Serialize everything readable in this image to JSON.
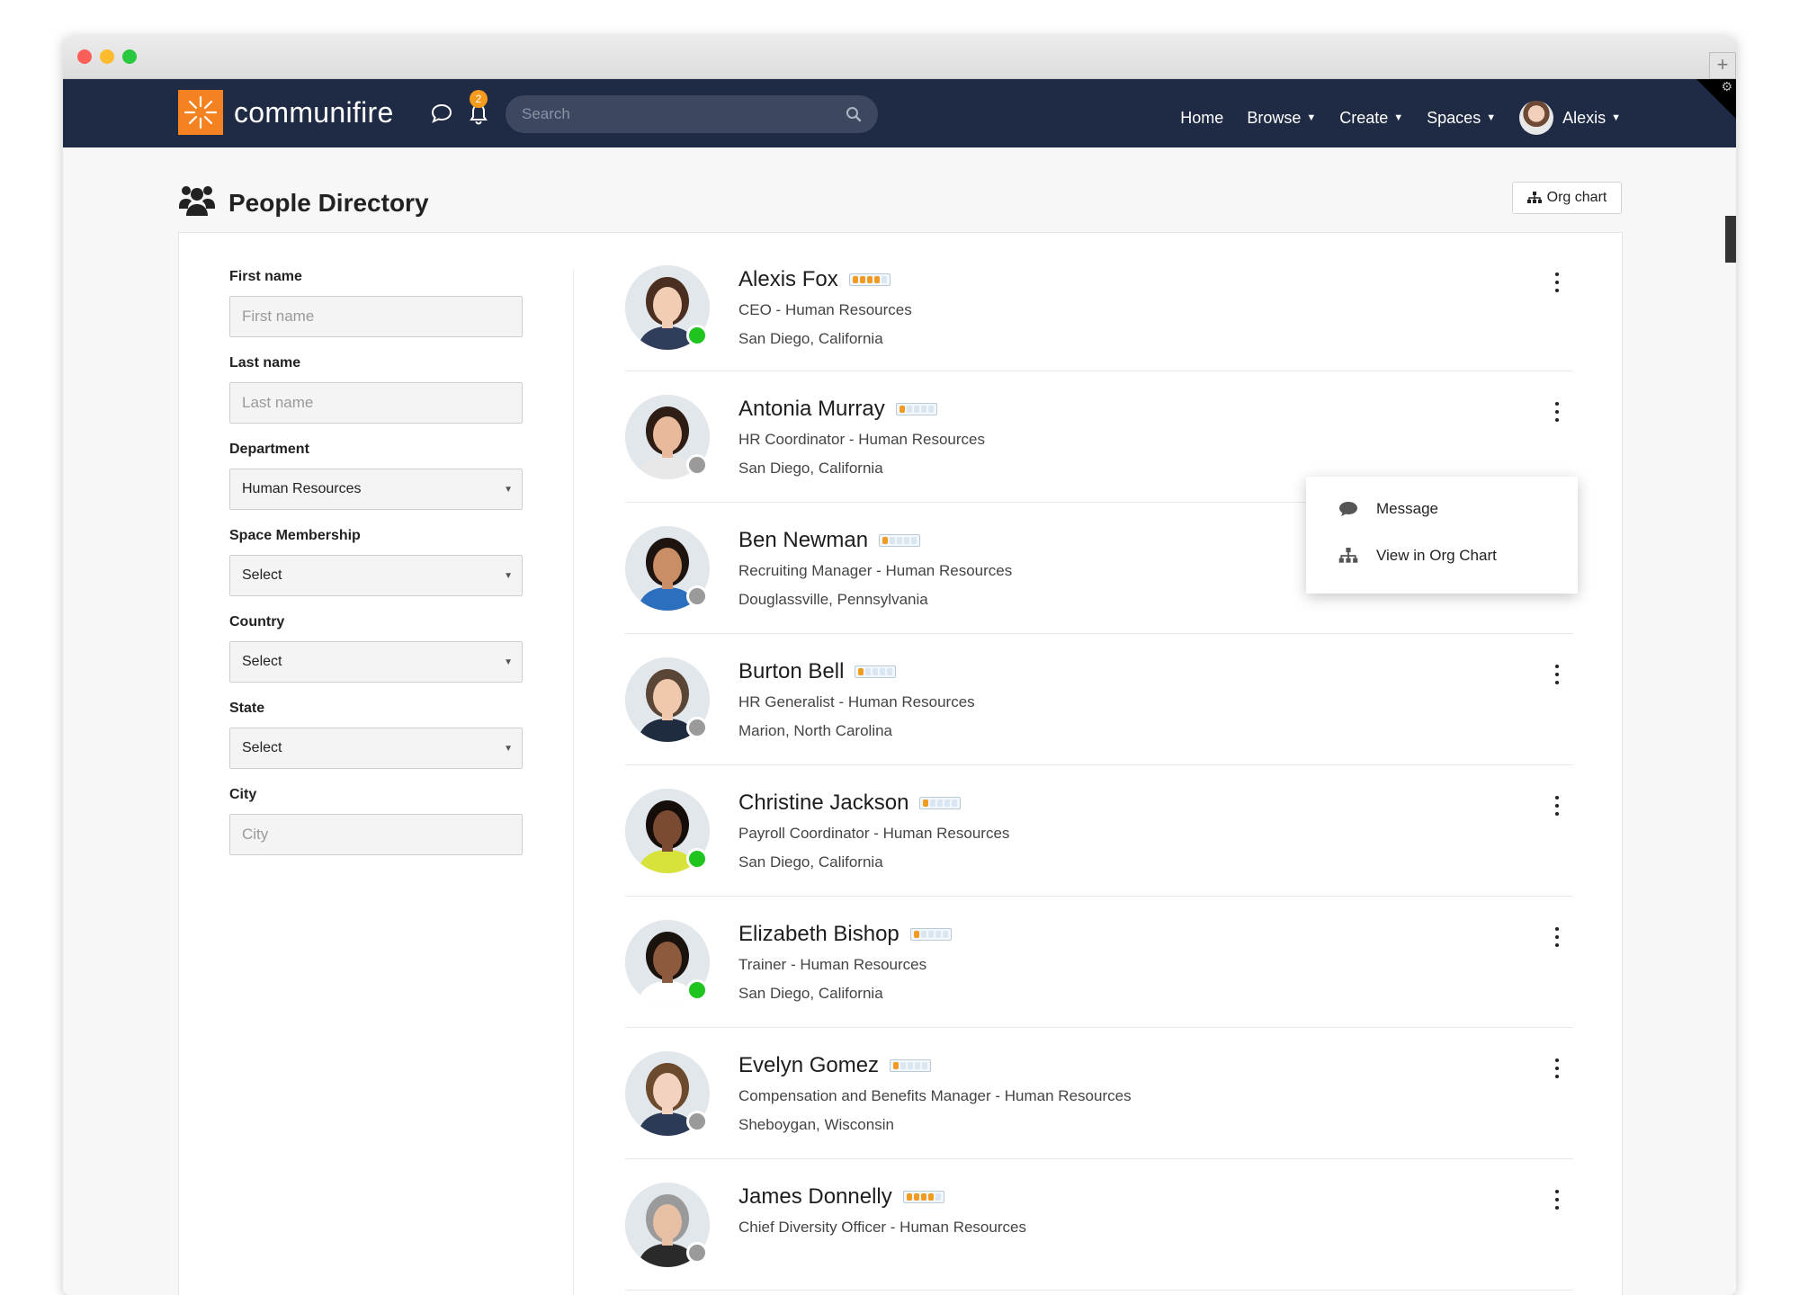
{
  "app": {
    "logo_text": "communifire"
  },
  "nav": {
    "notifications_count": "2",
    "search_placeholder": "Search",
    "home": "Home",
    "browse": "Browse",
    "create": "Create",
    "spaces": "Spaces",
    "user": "Alexis"
  },
  "page": {
    "title": "People Directory",
    "org_chart_button": "Org chart"
  },
  "filters": {
    "first_name_label": "First name",
    "first_name_placeholder": "First name",
    "last_name_label": "Last name",
    "last_name_placeholder": "Last name",
    "department_label": "Department",
    "department_value": "Human Resources",
    "space_label": "Space Membership",
    "space_value": "Select",
    "country_label": "Country",
    "country_value": "Select",
    "state_label": "State",
    "state_value": "Select",
    "city_label": "City",
    "city_placeholder": "City"
  },
  "people": [
    {
      "name": "Alexis Fox",
      "title": "CEO - Human Resources",
      "location": "San Diego, California",
      "status": "online",
      "rank": 4
    },
    {
      "name": "Antonia Murray",
      "title": "HR Coordinator - Human Resources",
      "location": "San Diego, California",
      "status": "offline",
      "rank": 1
    },
    {
      "name": "Ben Newman",
      "title": "Recruiting Manager - Human Resources",
      "location": "Douglassville, Pennsylvania",
      "status": "offline",
      "rank": 1
    },
    {
      "name": "Burton Bell",
      "title": "HR Generalist - Human Resources",
      "location": "Marion, North Carolina",
      "status": "offline",
      "rank": 1
    },
    {
      "name": "Christine Jackson",
      "title": "Payroll Coordinator - Human Resources",
      "location": "San Diego, California",
      "status": "online",
      "rank": 1
    },
    {
      "name": "Elizabeth Bishop",
      "title": "Trainer - Human Resources",
      "location": "San Diego, California",
      "status": "online",
      "rank": 1
    },
    {
      "name": "Evelyn Gomez",
      "title": "Compensation and Benefits Manager - Human Resources",
      "location": "Sheboygan, Wisconsin",
      "status": "offline",
      "rank": 1
    },
    {
      "name": "James Donnelly",
      "title": "Chief Diversity Officer - Human Resources",
      "location": "",
      "status": "offline",
      "rank": 4
    }
  ],
  "context_menu": {
    "message": "Message",
    "view_org_chart": "View in Org Chart"
  },
  "colors": {
    "nav_bg": "#1f2a44",
    "brand_orange": "#f58220",
    "online": "#1fc41f",
    "offline": "#9a9a9a",
    "rank_on": "#f19b22"
  }
}
